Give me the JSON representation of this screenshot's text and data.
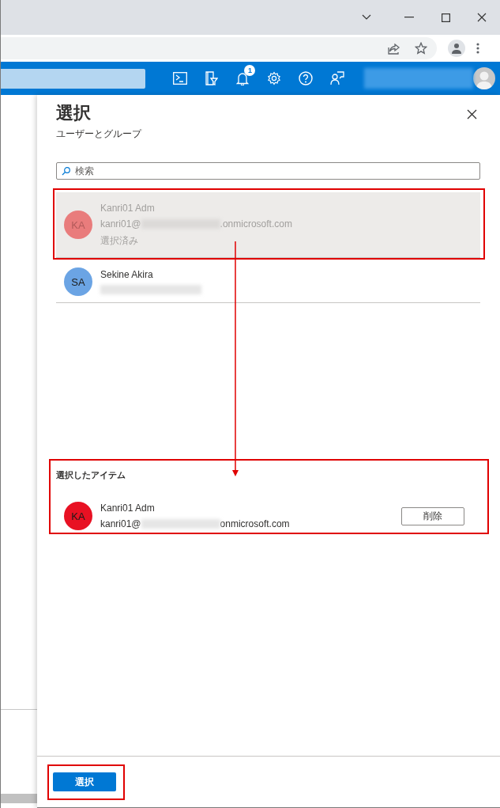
{
  "browser": {
    "notification_count": "1"
  },
  "panel": {
    "title": "選択",
    "subtitle": "ユーザーとグループ",
    "search": {
      "placeholder": "検索"
    },
    "results": [
      {
        "initials": "KA",
        "name": "Kanri01 Adm",
        "email_start": "kanri01@",
        "email_end": ".onmicrosoft.com",
        "email_hidden": true,
        "status": "選択済み",
        "selected": true,
        "color": "#e97c7c"
      },
      {
        "initials": "SA",
        "name": "Sekine Akira",
        "email_hidden": true,
        "selected": false,
        "color": "#6ba4e4"
      }
    ],
    "selected_heading": "選択したアイテム",
    "selected_items": [
      {
        "initials": "KA",
        "name": "Kanri01 Adm",
        "email_start": "kanri01@",
        "email_end": "onmicrosoft.com",
        "email_hidden": true,
        "remove_label": "削除",
        "color": "#e81123"
      }
    ],
    "submit_label": "選択"
  }
}
